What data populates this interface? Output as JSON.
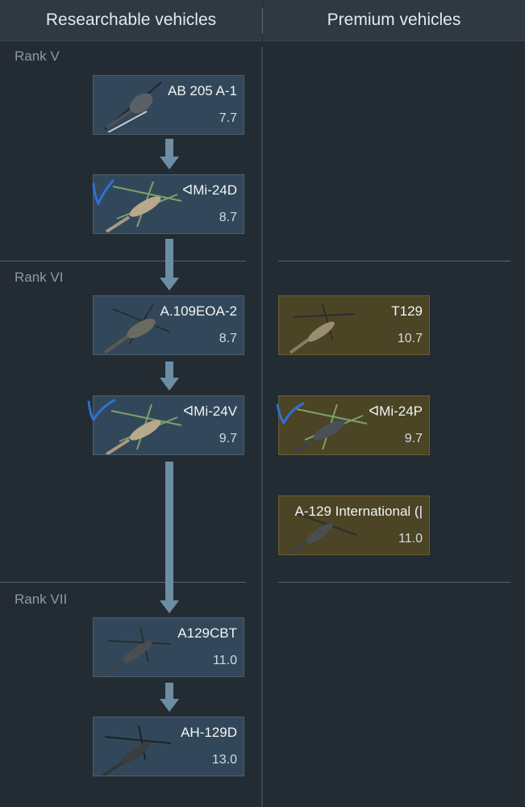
{
  "headers": {
    "researchable": "Researchable vehicles",
    "premium": "Premium vehicles"
  },
  "ranks": {
    "r5": "Rank V",
    "r6": "Rank VI",
    "r7": "Rank VII"
  },
  "researchable": [
    {
      "name": "AB 205 A-1",
      "br": "7.7"
    },
    {
      "name": "ᐊMi-24D",
      "br": "8.7",
      "checked": true
    },
    {
      "name": "A.109EOA-2",
      "br": "8.7"
    },
    {
      "name": "ᐊMi-24V",
      "br": "9.7",
      "checked": true
    },
    {
      "name": "A129CBT",
      "br": "11.0"
    },
    {
      "name": "AH-129D",
      "br": "13.0"
    }
  ],
  "premium": [
    {
      "name": "T129",
      "br": "10.7"
    },
    {
      "name": "ᐊMi-24P",
      "br": "9.7",
      "checked": true
    },
    {
      "name": "A-129 International (|",
      "br": "11.0"
    }
  ],
  "colors": {
    "researchable_card": "#32485a",
    "premium_card": "#4b4425",
    "arrow": "#6d8da5",
    "checkmark": "#2f6fd6"
  }
}
